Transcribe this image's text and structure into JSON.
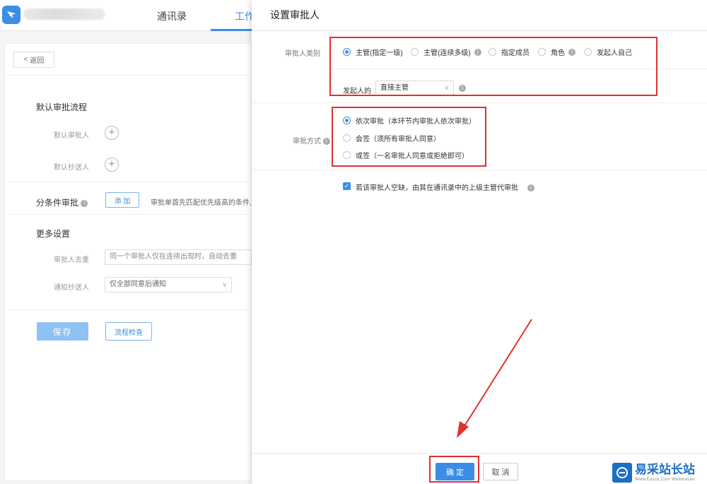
{
  "topbar": {
    "tabs": [
      {
        "label": "通讯录"
      },
      {
        "label": "工作"
      }
    ]
  },
  "background_page": {
    "back_label": "返回",
    "default_flow": {
      "title": "默认审批流程",
      "approver_label": "默认审批人",
      "cc_label": "默认抄送人"
    },
    "conditional": {
      "title": "分条件审批",
      "add_label": "添 加",
      "desc": "审批单首先匹配优先级高的条件,"
    },
    "more_settings": {
      "title": "更多设置",
      "dedupe_label": "审批人去重",
      "dedupe_value": "同一个审批人仅在连续出现时，自动去重",
      "notify_label": "通知抄送人",
      "notify_value": "仅全部同意后通知"
    },
    "save_label": "保存",
    "check_label": "流程检查"
  },
  "drawer": {
    "title": "设置审批人",
    "approver_type": {
      "label": "审批人类别",
      "options": [
        {
          "label": "主管(指定一级)",
          "checked": true
        },
        {
          "label": "主管(连续多级)",
          "checked": false
        },
        {
          "label": "指定成员",
          "checked": false
        },
        {
          "label": "角色",
          "checked": false
        },
        {
          "label": "发起人自己",
          "checked": false
        }
      ],
      "initiator_label": "发起人的",
      "supervisor_select": "直接主管"
    },
    "approval_method": {
      "label": "审批方式",
      "options": [
        {
          "label": "依次审批（本环节内审批人依次审批）",
          "checked": true
        },
        {
          "label": "会签（须所有审批人同意）",
          "checked": false
        },
        {
          "label": "或签（一名审批人同意或拒绝即可）",
          "checked": false
        }
      ]
    },
    "fallback_checkbox": "若该审批人空缺，由其在通讯录中的上级主管代审批",
    "ok_label": "确 定",
    "cancel_label": "取 消"
  },
  "watermark": {
    "cn": "易采站长站",
    "en": "Www.Easck.Com Webmaster"
  },
  "colors": {
    "accent": "#3a8ee6",
    "highlight": "#e0312f"
  },
  "icons": {
    "info": "info-icon",
    "plus": "plus-circle-icon",
    "back": "chevron-left-icon",
    "dropdown": "chevron-down-icon"
  }
}
